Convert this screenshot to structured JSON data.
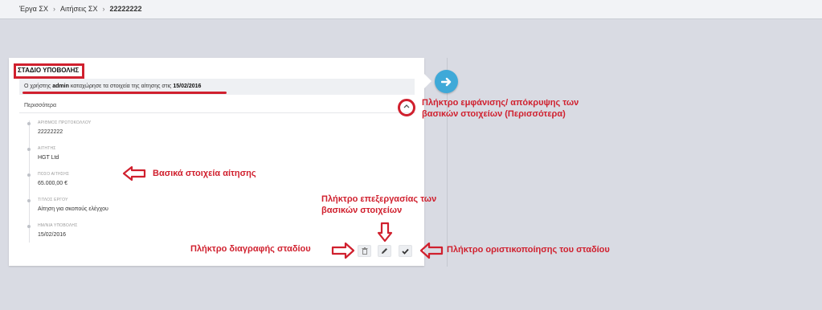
{
  "breadcrumb": {
    "items": [
      "Έργα ΣΧ",
      "Αιτήσεις ΣΧ"
    ],
    "current": "22222222"
  },
  "card": {
    "stage_title": "ΣΤΑΔΙΟ ΥΠΟΒΟΛΗΣ",
    "info": {
      "prefix": "Ο χρήστης",
      "user": "admin",
      "middle": "καταχώρησε τα στοιχεία της αίτησης στις",
      "date": "15/02/2016"
    },
    "more_label": "Περισσότερα",
    "fields": [
      {
        "label": "ΑΡΙΘΜΟΣ ΠΡΩΤΟΚΟΛΛΟΥ",
        "value": "22222222"
      },
      {
        "label": "ΑΙΤΗΤΗΣ",
        "value": "HGT Ltd"
      },
      {
        "label": "ΠΟΣΟ ΑΙΤΗΣΗΣ",
        "value": "65.000,00 €"
      },
      {
        "label": "ΤΙΤΛΟΣ ΕΡΓΟΥ",
        "value": "Αίτηση για σκοπούς ελέγχου"
      },
      {
        "label": "ΗΜ/ΝΙΑ ΥΠΟΒΟΛΗΣ",
        "value": "15/02/2016"
      }
    ],
    "buttons": {
      "delete_icon": "trash-icon",
      "edit_icon": "pencil-icon",
      "finalize_icon": "check-icon"
    }
  },
  "next_icon": "arrow-right-icon",
  "annotations": {
    "toggle": [
      "Πλήκτρο εμφάνισης/ απόκρυψης των",
      "βασικών στοιχείων (Περισσότερα)"
    ],
    "basic": "Βασικά στοιχεία αίτησης",
    "edit": [
      "Πλήκτρο επεξεργασίας των",
      "βασικών στοιχείων"
    ],
    "delete": "Πλήκτρο διαγραφής σταδίου",
    "finalize": "Πλήκτρο οριστικοποίησης του σταδίου"
  },
  "colors": {
    "accent": "#3fa9d8",
    "annotation": "#d0202e",
    "background": "#d9dbe3"
  }
}
